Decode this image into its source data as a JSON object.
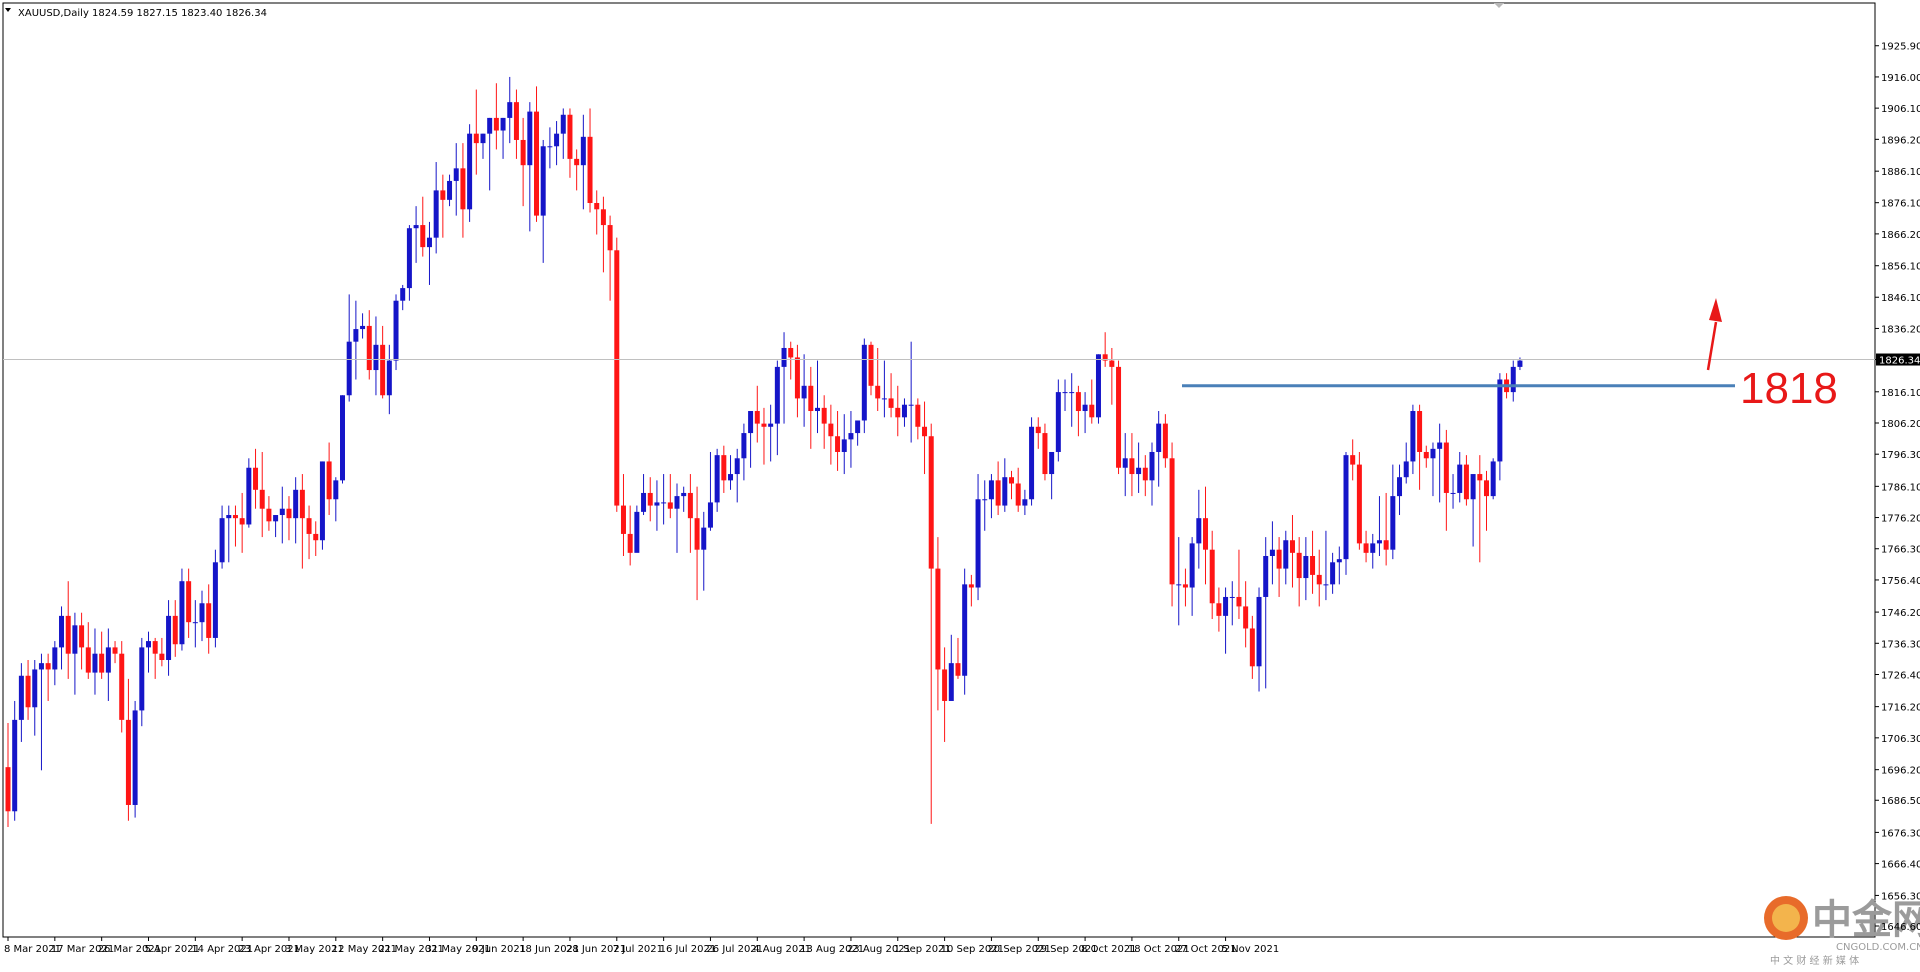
{
  "header": {
    "symbol": "XAUUSD,Daily",
    "ohlc": "1824.59 1827.15 1823.40 1826.34"
  },
  "annotation": {
    "level_label": "1818",
    "level_value": 1818,
    "line_color": "#4a80b8",
    "arrow_color": "#e81818"
  },
  "current_price": {
    "label": "1826.34",
    "value": 1826.34
  },
  "watermark": {
    "chinese": "中金网",
    "url": "CNGOLD.COM.CN",
    "tagline": "中 文 财 经 新 媒 体"
  },
  "chart_data": {
    "type": "candlestick",
    "title": "XAUUSD,Daily",
    "ylim": [
      1646.6,
      1934.7
    ],
    "colors": {
      "up": "#1515c8",
      "down": "#ff1515"
    },
    "y_tick_labels": [
      "1925.90",
      "1916.00",
      "1906.10",
      "1896.20",
      "1886.10",
      "1876.10",
      "1866.20",
      "1856.10",
      "1846.10",
      "1836.20",
      "1826.34",
      "1816.10",
      "1806.20",
      "1796.30",
      "1786.10",
      "1776.20",
      "1766.30",
      "1756.40",
      "1746.20",
      "1736.30",
      "1726.40",
      "1716.20",
      "1706.30",
      "1696.20",
      "1686.50",
      "1676.30",
      "1666.40",
      "1656.30",
      "1646.60"
    ],
    "x_tick_labels": [
      "8 Mar 2021",
      "17 Mar 2021",
      "26 Mar 2021",
      "5 Apr 2021",
      "14 Apr 2021",
      "23 Apr 2021",
      "3 May 2021",
      "12 May 2021",
      "21 May 2021",
      "31 May 2021",
      "9 Jun 2021",
      "18 Jun 2021",
      "28 Jun 2021",
      "7 Jul 2021",
      "16 Jul 2021",
      "26 Jul 2021",
      "4 Aug 2021",
      "13 Aug 2021",
      "23 Aug 2021",
      "1 Sep 2021",
      "10 Sep 2021",
      "20 Sep 2021",
      "29 Sep 2021",
      "8 Oct 2021",
      "18 Oct 2021",
      "27 Oct 2021",
      "5 Nov 2021"
    ],
    "ohlc": [
      [
        1697,
        1711,
        1678,
        1683
      ],
      [
        1683,
        1718,
        1680,
        1712
      ],
      [
        1712,
        1730,
        1705,
        1726
      ],
      [
        1726,
        1731,
        1712,
        1716
      ],
      [
        1716,
        1731,
        1707,
        1728
      ],
      [
        1728,
        1733,
        1696,
        1730
      ],
      [
        1730,
        1733,
        1718,
        1728
      ],
      [
        1728,
        1737,
        1723,
        1735
      ],
      [
        1735,
        1748,
        1728,
        1745
      ],
      [
        1745,
        1756,
        1725,
        1733
      ],
      [
        1733,
        1746,
        1720,
        1742
      ],
      [
        1742,
        1746,
        1728,
        1735
      ],
      [
        1735,
        1743,
        1725,
        1727
      ],
      [
        1727,
        1741,
        1720,
        1733
      ],
      [
        1733,
        1740,
        1725,
        1727
      ],
      [
        1727,
        1741,
        1718,
        1735
      ],
      [
        1735,
        1737,
        1730,
        1733
      ],
      [
        1733,
        1737,
        1708,
        1712
      ],
      [
        1712,
        1725,
        1680,
        1685
      ],
      [
        1685,
        1718,
        1681,
        1715
      ],
      [
        1715,
        1738,
        1710,
        1735
      ],
      [
        1735,
        1740,
        1727,
        1737
      ],
      [
        1737,
        1738,
        1725,
        1733
      ],
      [
        1733,
        1738,
        1729,
        1731
      ],
      [
        1731,
        1750,
        1726,
        1745
      ],
      [
        1745,
        1750,
        1732,
        1736
      ],
      [
        1736,
        1760,
        1734,
        1756
      ],
      [
        1756,
        1760,
        1738,
        1743
      ],
      [
        1743,
        1750,
        1735,
        1743
      ],
      [
        1743,
        1753,
        1737,
        1749
      ],
      [
        1749,
        1755,
        1733,
        1738
      ],
      [
        1738,
        1766,
        1735,
        1762
      ],
      [
        1762,
        1780,
        1760,
        1776
      ],
      [
        1776,
        1780,
        1762,
        1777
      ],
      [
        1777,
        1780,
        1767,
        1776
      ],
      [
        1776,
        1784,
        1765,
        1774
      ],
      [
        1774,
        1795,
        1773,
        1792
      ],
      [
        1792,
        1798,
        1779,
        1785
      ],
      [
        1785,
        1797,
        1770,
        1779
      ],
      [
        1779,
        1783,
        1772,
        1775
      ],
      [
        1775,
        1777,
        1770,
        1777
      ],
      [
        1777,
        1786,
        1768,
        1779
      ],
      [
        1779,
        1783,
        1769,
        1776
      ],
      [
        1776,
        1789,
        1768,
        1785
      ],
      [
        1785,
        1790,
        1760,
        1776
      ],
      [
        1776,
        1780,
        1763,
        1771
      ],
      [
        1771,
        1775,
        1764,
        1769
      ],
      [
        1769,
        1794,
        1766,
        1794
      ],
      [
        1794,
        1800,
        1777,
        1782
      ],
      [
        1782,
        1789,
        1775,
        1788
      ],
      [
        1788,
        1815,
        1787,
        1815
      ],
      [
        1815,
        1847,
        1813,
        1832
      ],
      [
        1832,
        1845,
        1820,
        1836
      ],
      [
        1836,
        1841,
        1833,
        1837
      ],
      [
        1837,
        1842,
        1820,
        1823
      ],
      [
        1823,
        1840,
        1815,
        1831
      ],
      [
        1831,
        1837,
        1814,
        1815
      ],
      [
        1815,
        1831,
        1809,
        1826
      ],
      [
        1826,
        1847,
        1823,
        1845
      ],
      [
        1845,
        1850,
        1842,
        1849
      ],
      [
        1849,
        1869,
        1845,
        1868
      ],
      [
        1868,
        1875,
        1857,
        1869
      ],
      [
        1869,
        1878,
        1859,
        1862
      ],
      [
        1862,
        1870,
        1850,
        1865
      ],
      [
        1865,
        1889,
        1860,
        1880
      ],
      [
        1880,
        1885,
        1865,
        1877
      ],
      [
        1877,
        1885,
        1875,
        1883
      ],
      [
        1883,
        1895,
        1872,
        1887
      ],
      [
        1887,
        1895,
        1865,
        1874
      ],
      [
        1874,
        1901,
        1870,
        1898
      ],
      [
        1898,
        1912,
        1885,
        1895
      ],
      [
        1895,
        1898,
        1890,
        1898
      ],
      [
        1898,
        1903,
        1880,
        1903
      ],
      [
        1903,
        1914,
        1893,
        1899
      ],
      [
        1899,
        1903,
        1890,
        1903
      ],
      [
        1903,
        1916,
        1895,
        1908
      ],
      [
        1908,
        1912,
        1890,
        1896
      ],
      [
        1896,
        1903,
        1875,
        1888
      ],
      [
        1888,
        1908,
        1867,
        1905
      ],
      [
        1905,
        1913,
        1870,
        1872
      ],
      [
        1872,
        1896,
        1857,
        1894
      ],
      [
        1894,
        1900,
        1887,
        1894
      ],
      [
        1894,
        1902,
        1888,
        1898
      ],
      [
        1898,
        1906,
        1890,
        1904
      ],
      [
        1904,
        1906,
        1884,
        1890
      ],
      [
        1890,
        1893,
        1880,
        1888
      ],
      [
        1888,
        1904,
        1874,
        1897
      ],
      [
        1897,
        1906,
        1873,
        1876
      ],
      [
        1876,
        1880,
        1866,
        1874
      ],
      [
        1874,
        1878,
        1854,
        1869
      ],
      [
        1869,
        1872,
        1845,
        1861
      ],
      [
        1861,
        1865,
        1778,
        1780
      ],
      [
        1780,
        1790,
        1764,
        1771
      ],
      [
        1771,
        1780,
        1761,
        1765
      ],
      [
        1765,
        1780,
        1768,
        1778
      ],
      [
        1778,
        1790,
        1777,
        1784
      ],
      [
        1784,
        1789,
        1775,
        1780
      ],
      [
        1780,
        1788,
        1772,
        1781
      ],
      [
        1781,
        1790,
        1774,
        1781
      ],
      [
        1781,
        1790,
        1776,
        1779
      ],
      [
        1779,
        1787,
        1765,
        1783
      ],
      [
        1783,
        1786,
        1778,
        1784
      ],
      [
        1784,
        1790,
        1765,
        1776
      ],
      [
        1776,
        1786,
        1750,
        1766
      ],
      [
        1766,
        1778,
        1753,
        1773
      ],
      [
        1773,
        1797,
        1772,
        1781
      ],
      [
        1781,
        1798,
        1778,
        1796
      ],
      [
        1796,
        1799,
        1784,
        1788
      ],
      [
        1788,
        1796,
        1785,
        1790
      ],
      [
        1790,
        1798,
        1781,
        1795
      ],
      [
        1795,
        1806,
        1788,
        1803
      ],
      [
        1803,
        1808,
        1792,
        1810
      ],
      [
        1810,
        1818,
        1800,
        1806
      ],
      [
        1806,
        1811,
        1793,
        1805
      ],
      [
        1805,
        1812,
        1794,
        1806
      ],
      [
        1806,
        1826,
        1796,
        1824
      ],
      [
        1824,
        1835,
        1806,
        1830
      ],
      [
        1830,
        1832,
        1820,
        1827
      ],
      [
        1827,
        1831,
        1808,
        1814
      ],
      [
        1814,
        1828,
        1805,
        1818
      ],
      [
        1818,
        1824,
        1798,
        1810
      ],
      [
        1810,
        1826,
        1803,
        1811
      ],
      [
        1811,
        1815,
        1798,
        1806
      ],
      [
        1806,
        1812,
        1793,
        1802
      ],
      [
        1802,
        1810,
        1791,
        1797
      ],
      [
        1797,
        1809,
        1790,
        1801
      ],
      [
        1801,
        1810,
        1792,
        1803
      ],
      [
        1803,
        1806,
        1799,
        1807
      ],
      [
        1807,
        1833,
        1803,
        1831
      ],
      [
        1831,
        1832,
        1815,
        1818
      ],
      [
        1818,
        1830,
        1810,
        1814
      ],
      [
        1814,
        1826,
        1808,
        1814
      ],
      [
        1814,
        1822,
        1808,
        1811
      ],
      [
        1811,
        1818,
        1802,
        1808
      ],
      [
        1808,
        1814,
        1805,
        1812
      ],
      [
        1812,
        1832,
        1800,
        1812
      ],
      [
        1812,
        1814,
        1801,
        1805
      ],
      [
        1805,
        1813,
        1790,
        1802
      ],
      [
        1802,
        1806,
        1679,
        1760
      ],
      [
        1760,
        1770,
        1715,
        1728
      ],
      [
        1728,
        1735,
        1705,
        1718
      ],
      [
        1718,
        1739,
        1720,
        1730
      ],
      [
        1730,
        1738,
        1725,
        1726
      ],
      [
        1726,
        1760,
        1720,
        1755
      ],
      [
        1755,
        1758,
        1748,
        1754
      ],
      [
        1754,
        1790,
        1750,
        1782
      ],
      [
        1782,
        1788,
        1772,
        1782
      ],
      [
        1782,
        1790,
        1776,
        1788
      ],
      [
        1788,
        1794,
        1777,
        1780
      ],
      [
        1780,
        1795,
        1778,
        1789
      ],
      [
        1789,
        1791,
        1782,
        1787
      ],
      [
        1787,
        1792,
        1778,
        1780
      ],
      [
        1780,
        1785,
        1777,
        1782
      ],
      [
        1782,
        1808,
        1780,
        1805
      ],
      [
        1805,
        1808,
        1798,
        1803
      ],
      [
        1803,
        1806,
        1788,
        1790
      ],
      [
        1790,
        1797,
        1782,
        1797
      ],
      [
        1797,
        1820,
        1794,
        1816
      ],
      [
        1816,
        1820,
        1810,
        1816
      ],
      [
        1816,
        1822,
        1805,
        1816
      ],
      [
        1816,
        1818,
        1802,
        1810
      ],
      [
        1810,
        1816,
        1803,
        1812
      ],
      [
        1812,
        1820,
        1806,
        1808
      ],
      [
        1808,
        1828,
        1806,
        1828
      ],
      [
        1828,
        1835,
        1824,
        1826
      ],
      [
        1826,
        1830,
        1812,
        1824
      ],
      [
        1824,
        1826,
        1790,
        1792
      ],
      [
        1792,
        1803,
        1783,
        1795
      ],
      [
        1795,
        1803,
        1783,
        1790
      ],
      [
        1790,
        1800,
        1784,
        1792
      ],
      [
        1792,
        1796,
        1783,
        1788
      ],
      [
        1788,
        1800,
        1780,
        1797
      ],
      [
        1797,
        1810,
        1786,
        1806
      ],
      [
        1806,
        1809,
        1792,
        1795
      ],
      [
        1795,
        1800,
        1748,
        1755
      ],
      [
        1755,
        1770,
        1742,
        1755
      ],
      [
        1755,
        1760,
        1748,
        1754
      ],
      [
        1754,
        1770,
        1745,
        1768
      ],
      [
        1768,
        1785,
        1760,
        1776
      ],
      [
        1776,
        1786,
        1755,
        1766
      ],
      [
        1766,
        1772,
        1744,
        1749
      ],
      [
        1749,
        1754,
        1740,
        1745
      ],
      [
        1745,
        1754,
        1733,
        1751
      ],
      [
        1751,
        1756,
        1742,
        1751
      ],
      [
        1751,
        1766,
        1744,
        1748
      ],
      [
        1748,
        1756,
        1735,
        1741
      ],
      [
        1741,
        1745,
        1725,
        1729
      ],
      [
        1729,
        1754,
        1721,
        1751
      ],
      [
        1751,
        1770,
        1722,
        1764
      ],
      [
        1764,
        1775,
        1755,
        1766
      ],
      [
        1766,
        1770,
        1751,
        1760
      ],
      [
        1760,
        1772,
        1755,
        1769
      ],
      [
        1769,
        1777,
        1754,
        1765
      ],
      [
        1765,
        1770,
        1748,
        1757
      ],
      [
        1757,
        1770,
        1750,
        1764
      ],
      [
        1764,
        1772,
        1752,
        1758
      ],
      [
        1758,
        1766,
        1748,
        1755
      ],
      [
        1755,
        1772,
        1750,
        1755
      ],
      [
        1755,
        1765,
        1752,
        1762
      ],
      [
        1762,
        1767,
        1755,
        1763
      ],
      [
        1763,
        1797,
        1758,
        1796
      ],
      [
        1796,
        1801,
        1788,
        1793
      ],
      [
        1793,
        1797,
        1766,
        1768
      ],
      [
        1768,
        1772,
        1762,
        1765
      ],
      [
        1765,
        1771,
        1760,
        1768
      ],
      [
        1768,
        1783,
        1764,
        1769
      ],
      [
        1769,
        1784,
        1761,
        1766
      ],
      [
        1766,
        1793,
        1763,
        1783
      ],
      [
        1783,
        1793,
        1777,
        1789
      ],
      [
        1789,
        1800,
        1787,
        1794
      ],
      [
        1794,
        1812,
        1790,
        1810
      ],
      [
        1810,
        1812,
        1785,
        1797
      ],
      [
        1797,
        1799,
        1792,
        1795
      ],
      [
        1795,
        1800,
        1783,
        1798
      ],
      [
        1798,
        1806,
        1781,
        1800
      ],
      [
        1800,
        1804,
        1772,
        1784
      ],
      [
        1784,
        1790,
        1779,
        1784
      ],
      [
        1784,
        1797,
        1781,
        1793
      ],
      [
        1793,
        1796,
        1780,
        1782
      ],
      [
        1782,
        1788,
        1767,
        1790
      ],
      [
        1790,
        1796,
        1762,
        1788
      ],
      [
        1788,
        1791,
        1772,
        1783
      ],
      [
        1783,
        1795,
        1782,
        1794
      ],
      [
        1794,
        1822,
        1788,
        1820
      ],
      [
        1820,
        1822,
        1814,
        1816
      ],
      [
        1816,
        1826,
        1813,
        1824
      ],
      [
        1824,
        1827,
        1823,
        1826
      ]
    ],
    "x_tick_candle_index": [
      0,
      7,
      14,
      21,
      28,
      35,
      42,
      49,
      56,
      63,
      70,
      77,
      84,
      91,
      98,
      105,
      112,
      119,
      126,
      133,
      140,
      147,
      154,
      161,
      168,
      175,
      182
    ]
  }
}
